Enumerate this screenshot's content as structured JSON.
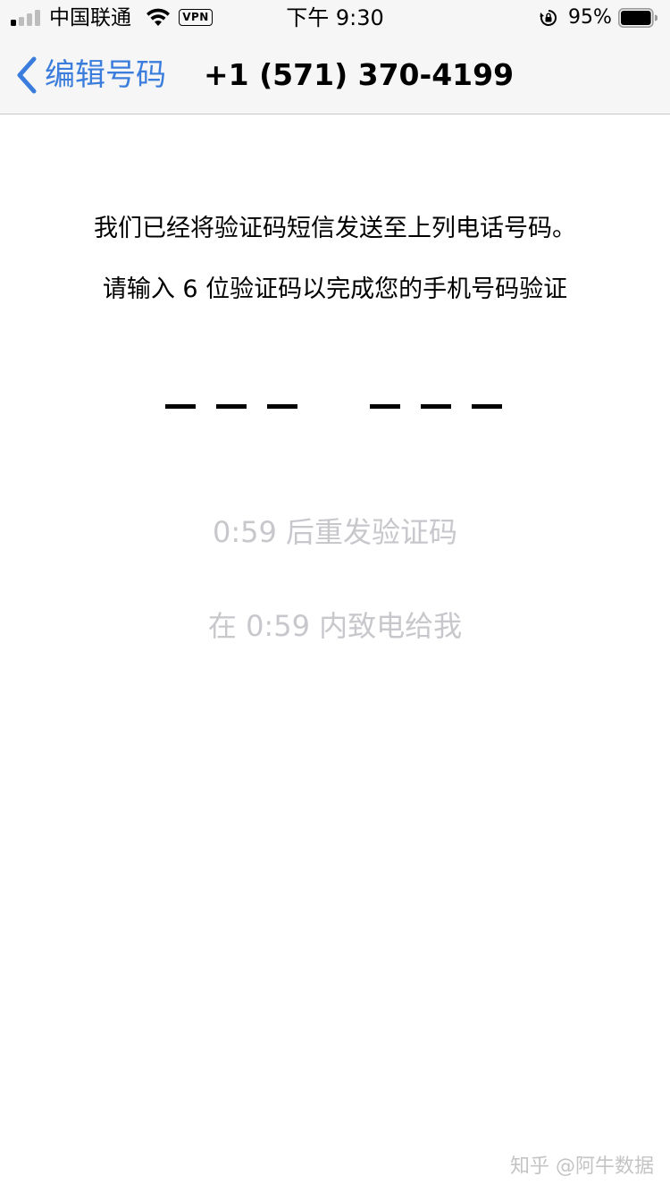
{
  "status_bar": {
    "carrier": "中国联通",
    "vpn_badge": "VPN",
    "time": "下午 9:30",
    "battery_percent": "95%",
    "battery_level": 0.95,
    "signal_bars_filled": 1,
    "signal_bars_total": 4,
    "icons": [
      "signal-icon",
      "wifi-icon",
      "rotation-lock-icon",
      "battery-icon"
    ]
  },
  "nav": {
    "back_label": "编辑号码",
    "title": "+1 (571) 370-4199",
    "accent_color": "#3b7ddd"
  },
  "main": {
    "instruction_line1": "我们已经将验证码短信发送至上列电话号码。",
    "instruction_line2": "请输入 6 位验证码以完成您的手机号码验证",
    "code_length": 6,
    "code_value": "",
    "resend_text": "0:59 后重发验证码",
    "call_text": "在 0:59 内致电给我",
    "disabled_color": "#c7c7cc"
  },
  "watermark": {
    "text": "知乎 @阿牛数据"
  }
}
